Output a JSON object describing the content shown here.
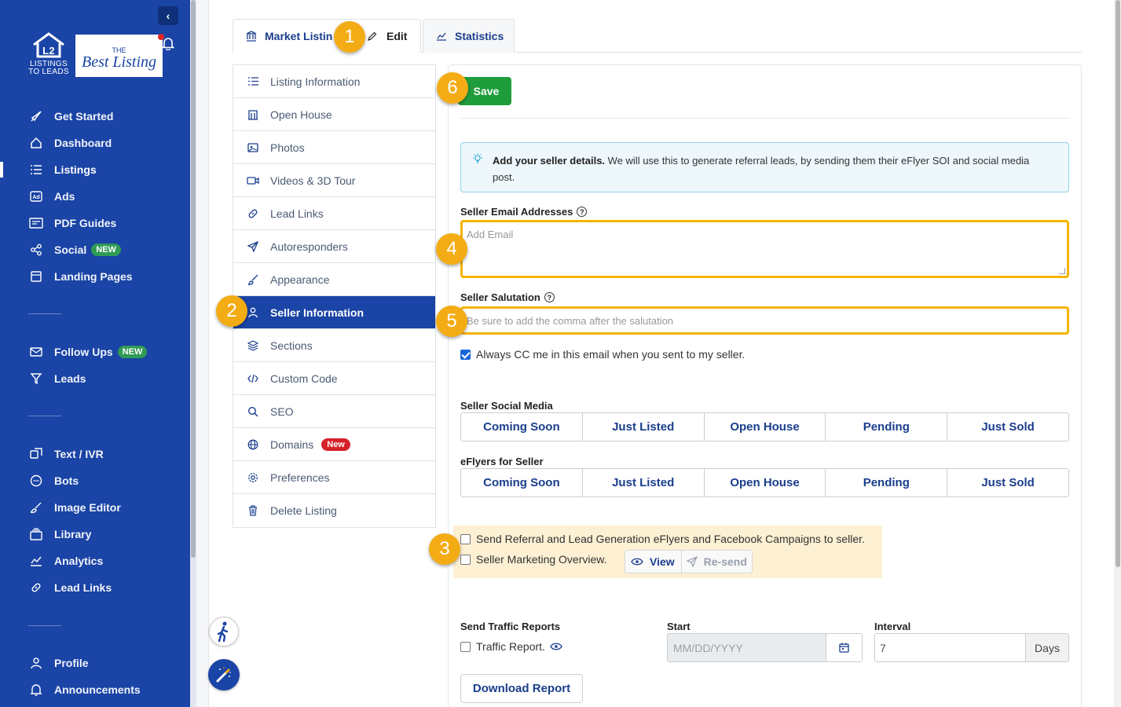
{
  "sidebar": {
    "logo_text_top": "LISTINGS",
    "logo_text_bottom": "TO LEADS",
    "brand_small": "THE",
    "brand_big": "Best Listing",
    "items": [
      {
        "label": "Get Started",
        "icon": "rocket-icon"
      },
      {
        "label": "Dashboard",
        "icon": "home-icon"
      },
      {
        "label": "Listings",
        "icon": "list-icon",
        "active": true
      },
      {
        "label": "Ads",
        "icon": "ad-icon"
      },
      {
        "label": "PDF Guides",
        "icon": "pdf-icon"
      },
      {
        "label": "Social",
        "icon": "share-icon",
        "badge": "NEW"
      },
      {
        "label": "Landing Pages",
        "icon": "page-icon"
      },
      {
        "label": "Follow Ups",
        "icon": "mail-icon",
        "badge": "NEW"
      },
      {
        "label": "Leads",
        "icon": "filter-icon"
      },
      {
        "label": "Text / IVR",
        "icon": "chat-icon"
      },
      {
        "label": "Bots",
        "icon": "bot-icon"
      },
      {
        "label": "Image Editor",
        "icon": "brush-icon"
      },
      {
        "label": "Library",
        "icon": "library-icon"
      },
      {
        "label": "Analytics",
        "icon": "analytics-icon"
      },
      {
        "label": "Lead Links",
        "icon": "link-icon"
      },
      {
        "label": "Profile",
        "icon": "user-icon"
      },
      {
        "label": "Announcements",
        "icon": "bell-icon"
      }
    ]
  },
  "tabs": {
    "market": "Market Listin",
    "edit": "Edit",
    "statistics": "Statistics"
  },
  "menu": {
    "items": [
      {
        "label": "Listing Information",
        "icon": "list-icon"
      },
      {
        "label": "Open House",
        "icon": "building-icon"
      },
      {
        "label": "Photos",
        "icon": "image-icon"
      },
      {
        "label": "Videos & 3D Tour",
        "icon": "video-icon"
      },
      {
        "label": "Lead Links",
        "icon": "link-icon"
      },
      {
        "label": "Autoresponders",
        "icon": "send-icon"
      },
      {
        "label": "Appearance",
        "icon": "brush-icon"
      },
      {
        "label": "Seller Information",
        "icon": "user-icon",
        "active": true
      },
      {
        "label": "Sections",
        "icon": "layers-icon"
      },
      {
        "label": "Custom Code",
        "icon": "code-icon"
      },
      {
        "label": "SEO",
        "icon": "search-icon"
      },
      {
        "label": "Domains",
        "icon": "globe-icon",
        "badge": "New"
      },
      {
        "label": "Preferences",
        "icon": "gear-icon"
      },
      {
        "label": "Delete Listing",
        "icon": "trash-icon"
      }
    ]
  },
  "content": {
    "save_label": "Save",
    "info_bold": "Add your seller details.",
    "info_text": " We will use this to generate referral leads, by sending them their eFlyer SOI and social media post.",
    "email_label": "Seller Email Addresses",
    "email_placeholder": "Add Email",
    "salutation_label": "Seller Salutation",
    "salutation_placeholder": "Be sure to add the comma after the salutation",
    "cc_label": "Always CC me in this email when you sent to my seller.",
    "cc_checked": true,
    "social_label": "Seller Social Media",
    "social_buttons": [
      "Coming Soon",
      "Just Listed",
      "Open House",
      "Pending",
      "Just Sold"
    ],
    "eflyers_label": "eFlyers for Seller",
    "eflyer_buttons": [
      "Coming Soon",
      "Just Listed",
      "Open House",
      "Pending",
      "Just Sold"
    ],
    "referral_label": "Send Referral and Lead Generation eFlyers and Facebook Campaigns to seller.",
    "overview_label": "Seller Marketing Overview.",
    "view_label": "View",
    "resend_label": "Re-send",
    "traffic_heading": "Send Traffic Reports",
    "traffic_label": "Traffic Report.",
    "start_label": "Start",
    "start_placeholder": "MM/DD/YYYY",
    "interval_label": "Interval",
    "interval_value": "7",
    "interval_unit": "Days",
    "download_label": "Download Report"
  },
  "markers": [
    "1",
    "2",
    "3",
    "4",
    "5",
    "6"
  ],
  "colors": {
    "sidebar": "#1a44a5",
    "accent": "#1a3e8c",
    "save": "#1f9d3c",
    "marker": "#f4ac14",
    "highlight": "#f4b400"
  }
}
